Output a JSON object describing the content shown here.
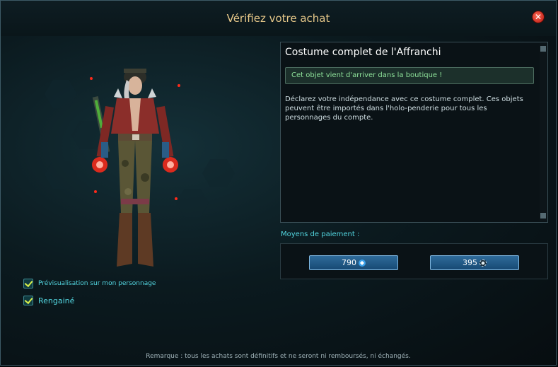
{
  "window": {
    "title": "Vérifiez votre achat"
  },
  "options": {
    "preview_label": "Prévisualisation sur mon personnage",
    "preview_checked": true,
    "sheathed_label": "Rengainé",
    "sheathed_checked": true
  },
  "item": {
    "name": "Costume complet de l'Affranchi",
    "banner": "Cet objet vient d'arriver dans la boutique !",
    "description": "Déclarez votre indépendance avec ce costume complet. Ces objets peuvent être importés dans l'holo-penderie pour tous les personnages du compte."
  },
  "payment": {
    "label": "Moyens de paiement :",
    "options": [
      {
        "amount": "790",
        "icon": "cosmic-credit-icon"
      },
      {
        "amount": "395",
        "icon": "omnibit-icon"
      }
    ]
  },
  "footer": {
    "remark": "Remarque : tous les achats sont définitifs et ne seront ni remboursés, ni échangés."
  },
  "colors": {
    "accent_cyan": "#53d6e0",
    "title_gold": "#e8c98a",
    "banner_green": "#8ee29a",
    "button_blue": "#2f6b9a",
    "close_red": "#d0221a"
  }
}
